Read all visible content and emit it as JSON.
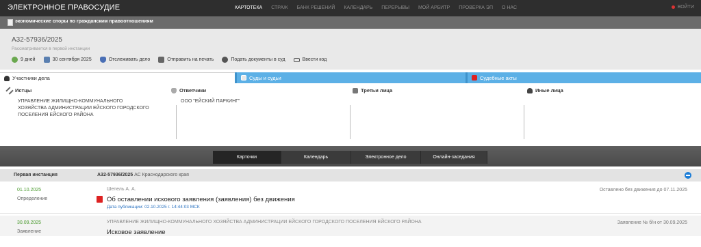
{
  "header": {
    "logo": "ЭЛЕКТРОННОЕ ПРАВОСУДИЕ",
    "nav": [
      "КАРТОТЕКА",
      "СТРАЖ",
      "БАНК РЕШЕНИЙ",
      "КАЛЕНДАРЬ",
      "ПЕРЕРЫВЫ",
      "МОЙ АРБИТР",
      "ПРОВЕРКА ЭП",
      "О НАС"
    ],
    "login": "ВОЙТИ"
  },
  "category": "экономические споры по гражданским правоотношениям",
  "case": {
    "number": "А32-57936/2025",
    "status": "Рассматривается в первой инстанции",
    "actions": {
      "days": "9 дней",
      "date": "30 сентября 2025",
      "track": "Отслеживать дело",
      "print": "Отправить на печать",
      "submit": "Подать документы в суд",
      "code": "Ввести код"
    }
  },
  "tabs": [
    "Участники дела",
    "Суды и судьи",
    "Судебные акты"
  ],
  "participants": {
    "plaintiffs": {
      "title": "Истцы",
      "lines": [
        "УПРАВЛЕНИЕ ЖИЛИЩНО-КОММУНАЛЬНОГО",
        "ХОЗЯЙСТВА АДМИНИСТРАЦИИ ЕЙСКОГО ГОРОДСКОГО",
        "ПОСЕЛЕНИЯ ЕЙСКОГО РАЙОНА"
      ]
    },
    "defendants": {
      "title": "Ответчики",
      "lines": [
        "ООО \"ЕЙСКИЙ ПАРКИНГ\""
      ]
    },
    "third": {
      "title": "Третьи лица"
    },
    "other": {
      "title": "Иные лица"
    }
  },
  "subtabs": [
    "Карточки",
    "Календарь",
    "Электронное дело",
    "Онлайн-заседания"
  ],
  "instance": {
    "label": "Первая инстанция",
    "case_bold": "А32-57936/2025",
    "court": " АС Краснодарского края"
  },
  "entries": [
    {
      "date": "01.10.2025",
      "type": "Определение",
      "who": "Шепель А. А.",
      "title": "Об оставлении искового заявления (заявления) без движения",
      "pub": "Дата публикации: 02.10.2025 г. 14:44:03 МСК",
      "note": "Оставлено без движения до 07.11.2025"
    },
    {
      "date": "30.09.2025",
      "type": "Заявление",
      "who": "УПРАВЛЕНИЕ ЖИЛИЩНО-КОММУНАЛЬНОГО ХОЗЯЙСТВА АДМИНИСТРАЦИИ ЕЙСКОГО ГОРОДСКОГО ПОСЕЛЕНИЯ ЕЙСКОГО РАЙОНА",
      "title": "Исковое заявление",
      "note": "Заявление № б/н от 30.09.2025"
    }
  ]
}
